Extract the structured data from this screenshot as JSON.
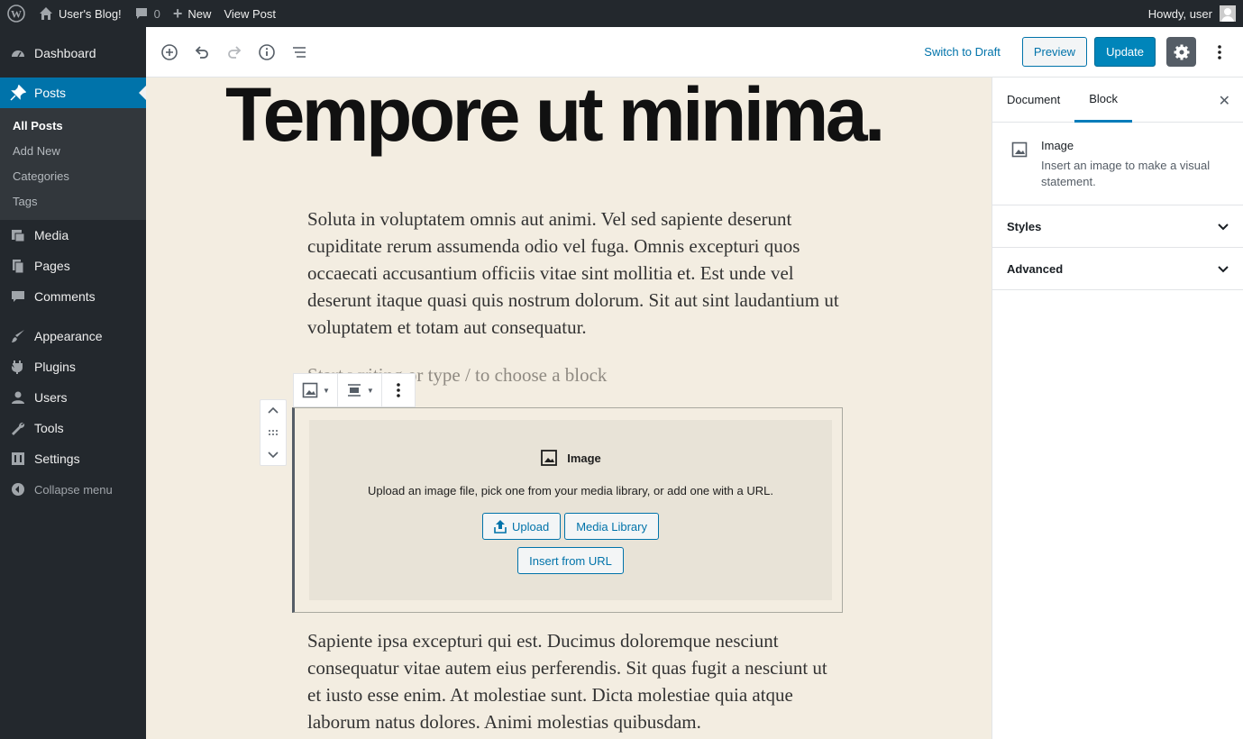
{
  "admin_bar": {
    "site_name": "User's Blog!",
    "comments_count": "0",
    "new_label": "New",
    "view_post_label": "View Post",
    "howdy": "Howdy, user"
  },
  "admin_menu": {
    "dashboard": "Dashboard",
    "posts": "Posts",
    "posts_submenu": [
      "All Posts",
      "Add New",
      "Categories",
      "Tags"
    ],
    "media": "Media",
    "pages": "Pages",
    "comments": "Comments",
    "appearance": "Appearance",
    "plugins": "Plugins",
    "users": "Users",
    "tools": "Tools",
    "settings": "Settings",
    "collapse": "Collapse menu"
  },
  "header": {
    "switch_to_draft": "Switch to Draft",
    "preview": "Preview",
    "update": "Update"
  },
  "post": {
    "title": "Tempore ut minima.",
    "paragraph1": "Soluta in voluptatem omnis aut animi. Vel sed sapiente deserunt cupiditate rerum assumenda odio vel fuga. Omnis excepturi quos occaecati accusantium officiis vitae sint mollitia et. Est unde vel deserunt itaque quasi quis nostrum dolorum. Sit aut sint laudantium ut voluptatem et totam aut consequatur.",
    "placeholder": "Start writing or type / to choose a block",
    "paragraph2": "Sapiente ipsa excepturi qui est. Ducimus doloremque nesciunt consequatur vitae autem eius perferendis. Sit quas fugit a nesciunt ut et iusto esse enim. At molestiae sunt. Dicta molestiae quia atque laborum natus dolores. Animi molestias quibusdam."
  },
  "image_block": {
    "label": "Image",
    "instructions": "Upload an image file, pick one from your media library, or add one with a URL.",
    "upload": "Upload",
    "media_library": "Media Library",
    "insert_from_url": "Insert from URL"
  },
  "sidebar": {
    "tabs": [
      "Document",
      "Block"
    ],
    "active_tab": "Block",
    "block_title": "Image",
    "block_description": "Insert an image to make a visual statement.",
    "panels": [
      "Styles",
      "Advanced"
    ]
  },
  "colors": {
    "accent": "#0073aa",
    "admin_dark": "#23282d",
    "content_bg": "#f3ede1"
  }
}
